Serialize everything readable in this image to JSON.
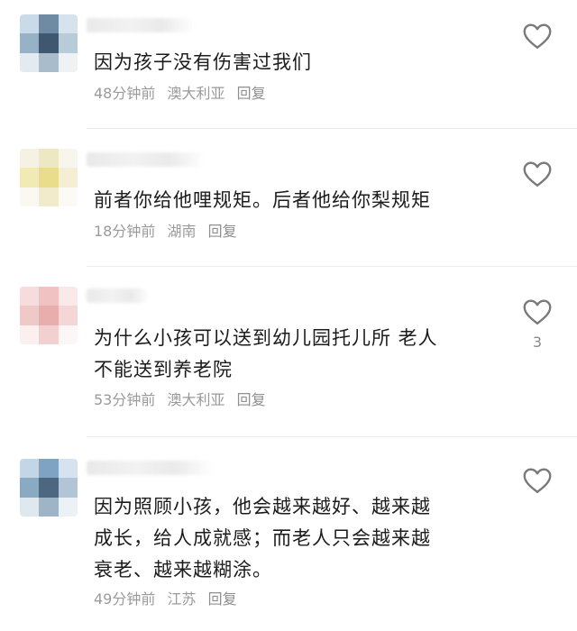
{
  "icons": {
    "like": "heart-outline-icon"
  },
  "colors": {
    "text": "#1c1c1c",
    "meta": "#9a9a9a",
    "divider": "#ececec",
    "icon": "#7a7a7a"
  },
  "comments": [
    {
      "text": "因为孩子没有伤害过我们",
      "time": "48分钟前",
      "location": "澳大利亚",
      "reply": "回复",
      "like_count": ""
    },
    {
      "text": "前者你给他哩规矩。后者他给你梨规矩",
      "time": "18分钟前",
      "location": "湖南",
      "reply": "回复",
      "like_count": ""
    },
    {
      "text_lines": [
        "为什么小孩可以送到幼儿园托儿所 老人",
        "不能送到养老院"
      ],
      "time": "53分钟前",
      "location": "澳大利亚",
      "reply": "回复",
      "like_count": "3"
    },
    {
      "text_lines": [
        "因为照顾小孩，他会越来越好、越来越",
        "成长，给人成就感；而老人只会越来越",
        "衰老、越来越糊涂。"
      ],
      "time": "49分钟前",
      "location": "江苏",
      "reply": "回复",
      "like_count": ""
    }
  ]
}
